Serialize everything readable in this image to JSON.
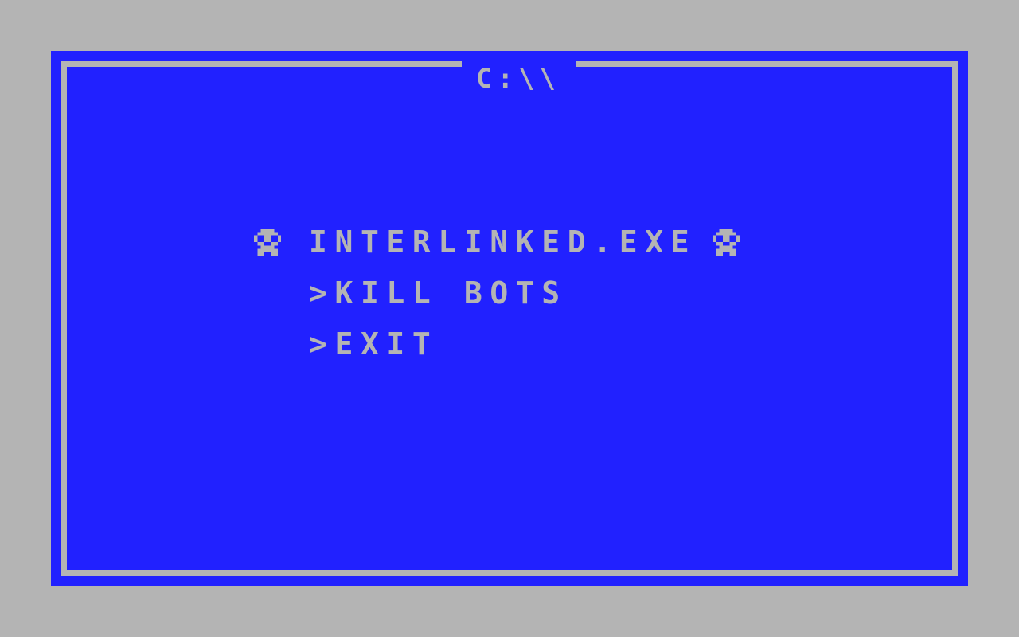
{
  "window": {
    "title": "C:\\\\"
  },
  "menu": {
    "title": "INTERLINKED.EXE",
    "left_icon": "skull-icon",
    "right_icon": "skull-icon",
    "items": [
      {
        "label": ">KILL BOTS"
      },
      {
        "label": ">EXIT"
      }
    ]
  },
  "colors": {
    "background": "#b4b4b4",
    "screen": "#2121ff",
    "text": "#b4b4b4"
  }
}
